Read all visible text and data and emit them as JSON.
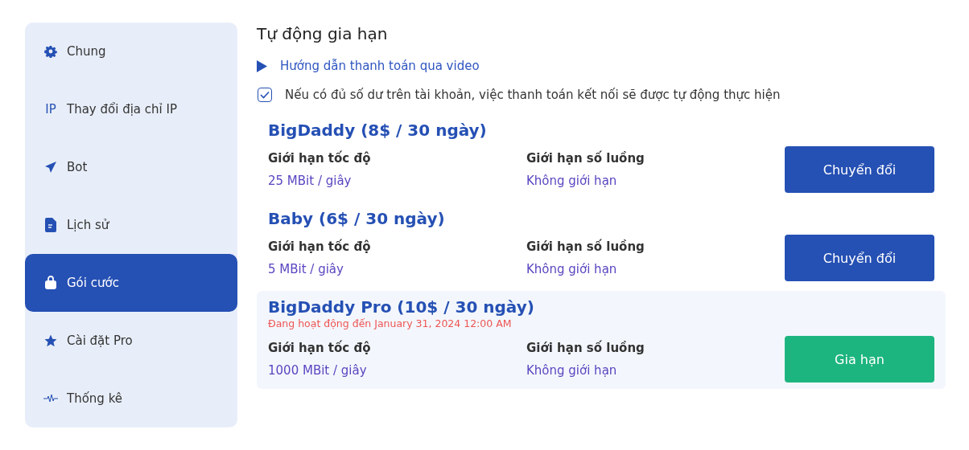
{
  "sidebar": {
    "items": [
      {
        "label": "Chung",
        "kind": "general",
        "selected": false
      },
      {
        "label": "Thay đổi địa chỉ IP",
        "kind": "ip",
        "icon_text": "IP",
        "selected": false
      },
      {
        "label": "Bot",
        "kind": "bot",
        "selected": false
      },
      {
        "label": "Lịch sử",
        "kind": "history",
        "selected": false
      },
      {
        "label": "Gói cước",
        "kind": "plans",
        "selected": true
      },
      {
        "label": "Cài đặt Pro",
        "kind": "pro",
        "selected": false
      },
      {
        "label": "Thống kê",
        "kind": "stats",
        "selected": false
      }
    ]
  },
  "heading": "Tự động gia hạn",
  "video_link": "Hướng dẫn thanh toán qua video",
  "auto_renew": {
    "label": "Nếu có đủ số dư trên tài khoản, việc thanh toán kết nối sẽ được tự động thực hiện",
    "checked": true
  },
  "plans": [
    {
      "title": "BigDaddy (8$ / 30 ngày)",
      "active": false,
      "speed_label": "Giới hạn tốc độ",
      "speed": "25 MBit / giây",
      "threads_label": "Giới hạn số luồng",
      "threads": "Không giới hạn",
      "button": {
        "label": "Chuyển đổi",
        "kind": "switch"
      }
    },
    {
      "title": "Baby (6$ / 30 ngày)",
      "active": false,
      "speed_label": "Giới hạn tốc độ",
      "speed": "5 MBit / giây",
      "threads_label": "Giới hạn số luồng",
      "threads": "Không giới hạn",
      "button": {
        "label": "Chuyển đổi",
        "kind": "switch"
      }
    },
    {
      "title": "BigDaddy Pro (10$ / 30 ngày)",
      "active": true,
      "status": "Đang hoạt động đến January 31, 2024 12:00 AM",
      "speed_label": "Giới hạn tốc độ",
      "speed": "1000 MBit / giây",
      "threads_label": "Giới hạn số luồng",
      "threads": "Không giới hạn",
      "button": {
        "label": "Gia hạn",
        "kind": "renew"
      }
    }
  ]
}
